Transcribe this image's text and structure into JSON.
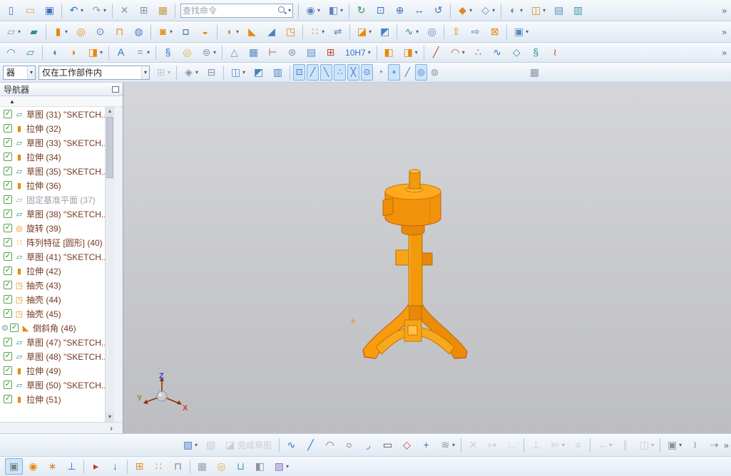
{
  "search": {
    "placeholder": "查找命令"
  },
  "navigator": {
    "title": "导航器",
    "sort_indicator": "▲",
    "expand_glyph": "›",
    "check_glyph": "✓",
    "scroll_up_glyph": "▲",
    "scroll_down_glyph": "▼",
    "icon_glyphs": {
      "sketch": [
        "▱",
        "#2e8f8f"
      ],
      "extrude": [
        "▮",
        "#e8890a"
      ],
      "datum-plane": [
        "▱",
        "#8a94a0"
      ],
      "revolve": [
        "◎",
        "#e8890a"
      ],
      "pattern": [
        "∷",
        "#e8890a"
      ],
      "shell": [
        "◳",
        "#e8890a"
      ],
      "chamfer": [
        "◣",
        "#e8890a"
      ]
    },
    "items": [
      {
        "label": "草图 (31) \"SKETCH...",
        "icon": "sketch"
      },
      {
        "label": "拉伸 (32)",
        "icon": "extrude"
      },
      {
        "label": "草图 (33) \"SKETCH...",
        "icon": "sketch"
      },
      {
        "label": "拉伸 (34)",
        "icon": "extrude"
      },
      {
        "label": "草图 (35) \"SKETCH...",
        "icon": "sketch"
      },
      {
        "label": "拉伸 (36)",
        "icon": "extrude"
      },
      {
        "label": "固定基准平面 (37)",
        "icon": "datum-plane",
        "muted": true
      },
      {
        "label": "草图 (38) \"SKETCH...",
        "icon": "sketch"
      },
      {
        "label": "旋转 (39)",
        "icon": "revolve"
      },
      {
        "label": "阵列特征 [圆形] (40)",
        "icon": "pattern"
      },
      {
        "label": "草图 (41) \"SKETCH...",
        "icon": "sketch"
      },
      {
        "label": "拉伸 (42)",
        "icon": "extrude"
      },
      {
        "label": "抽壳 (43)",
        "icon": "shell"
      },
      {
        "label": "抽壳 (44)",
        "icon": "shell"
      },
      {
        "label": "抽壳 (45)",
        "icon": "shell"
      },
      {
        "label": "倒斜角 (46)",
        "icon": "chamfer",
        "info": true
      },
      {
        "label": "草图 (47) \"SKETCH...",
        "icon": "sketch"
      },
      {
        "label": "草图 (48) \"SKETCH...",
        "icon": "sketch"
      },
      {
        "label": "拉伸 (49)",
        "icon": "extrude"
      },
      {
        "label": "草图 (50) \"SKETCH...",
        "icon": "sketch"
      },
      {
        "label": "拉伸 (51)",
        "icon": "extrude"
      }
    ]
  },
  "viewport": {
    "cursor_marker": "+",
    "triad": {
      "x": "X",
      "y": "Y",
      "z": "Z"
    }
  },
  "toolbars": {
    "row1": [
      {
        "n": "new-file-button",
        "g": "▯",
        "c": "#4a7fc1"
      },
      {
        "n": "open-button",
        "g": "▭",
        "c": "#e8a33d"
      },
      {
        "n": "save-button",
        "g": "▣",
        "c": "#3f6fbf"
      },
      {
        "sep": true
      },
      {
        "n": "undo-button",
        "g": "↶",
        "c": "#2f6fd0",
        "dd": true
      },
      {
        "n": "redo-button",
        "g": "↷",
        "c": "#8fa3c0",
        "dd": true
      },
      {
        "sep": true
      },
      {
        "n": "cut-button",
        "g": "✕",
        "c": "#8a94a0"
      },
      {
        "n": "copy-button",
        "g": "⊞",
        "c": "#8a94a0"
      },
      {
        "n": "paste-button",
        "g": "▦",
        "c": "#c89a3f"
      },
      {
        "sep": true
      },
      {
        "search": true
      },
      {
        "sep": true
      },
      {
        "n": "touch-mode-button",
        "g": "◉",
        "c": "#5a87c5",
        "dd": true
      },
      {
        "n": "window-button",
        "g": "◧",
        "c": "#5a87c5",
        "dd": true
      },
      {
        "sep": true
      },
      {
        "n": "refresh-view-button",
        "g": "↻",
        "c": "#2f8f4f"
      },
      {
        "n": "fit-view-button",
        "g": "⊡",
        "c": "#3f6fbf"
      },
      {
        "n": "zoom-in-button",
        "g": "⊕",
        "c": "#3f6fbf"
      },
      {
        "n": "pan-view-button",
        "g": "↔",
        "c": "#3f6fbf"
      },
      {
        "n": "rotate-view-button",
        "g": "↺",
        "c": "#3f6fbf"
      },
      {
        "sep": true
      },
      {
        "n": "shaded-display-button",
        "g": "◆",
        "c": "#d98a2b",
        "dd": true
      },
      {
        "n": "wireframe-display-button",
        "g": "◇",
        "c": "#6a7fd0",
        "dd": true
      },
      {
        "sep": true
      },
      {
        "n": "show-hide-button",
        "g": "◐",
        "c": "#5a87c5",
        "dd": true
      },
      {
        "n": "view-section-button",
        "g": "◫",
        "c": "#d98a2b",
        "dd": true
      },
      {
        "n": "layer-settings-button",
        "g": "▤",
        "c": "#5a87c5"
      },
      {
        "n": "true-shading-button",
        "g": "▥",
        "c": "#3aa0a0"
      },
      {
        "chev": true,
        "n": "row1-overflow"
      }
    ],
    "row2": [
      {
        "n": "datum-plane-button",
        "g": "▱",
        "c": "#8a94a0",
        "dd": true
      },
      {
        "n": "sketch-button",
        "g": "▰",
        "c": "#2e8f8f"
      },
      {
        "sep": true
      },
      {
        "n": "extrude-button",
        "g": "▮",
        "c": "#e8890a",
        "dd": true
      },
      {
        "n": "revolve-button",
        "g": "◎",
        "c": "#e8890a"
      },
      {
        "n": "hole-button",
        "g": "⊙",
        "c": "#4a7fc1"
      },
      {
        "n": "rib-button",
        "g": "⊓",
        "c": "#e8890a"
      },
      {
        "n": "boss-button",
        "g": "◍",
        "c": "#4a7fc1"
      },
      {
        "sep": true
      },
      {
        "n": "unite-button",
        "g": "◙",
        "c": "#e8890a",
        "dd": true
      },
      {
        "n": "subtract-button",
        "g": "◘",
        "c": "#4a7fc1"
      },
      {
        "n": "intersect-button",
        "g": "◒",
        "c": "#e8890a"
      },
      {
        "sep": true
      },
      {
        "n": "edge-blend-button",
        "g": "◗",
        "c": "#e8890a",
        "dd": true
      },
      {
        "n": "chamfer-button",
        "g": "◣",
        "c": "#e8890a"
      },
      {
        "n": "draft-button",
        "g": "◢",
        "c": "#4a7fc1"
      },
      {
        "n": "shell-button",
        "g": "◳",
        "c": "#e8890a"
      },
      {
        "sep": true
      },
      {
        "n": "pattern-feature-button",
        "g": "∷",
        "c": "#e8890a",
        "dd": true
      },
      {
        "n": "mirror-feature-button",
        "g": "⇌",
        "c": "#4a7fc1"
      },
      {
        "sep": true
      },
      {
        "n": "trim-body-button",
        "g": "◪",
        "c": "#e8890a",
        "dd": true
      },
      {
        "n": "split-body-button",
        "g": "◩",
        "c": "#4a7fc1"
      },
      {
        "sep": true
      },
      {
        "n": "swept-button",
        "g": "∿",
        "c": "#2e8f8f",
        "dd": true
      },
      {
        "n": "tube-button",
        "g": "◎",
        "c": "#4a7fc1"
      },
      {
        "sep": true
      },
      {
        "n": "offset-face-button",
        "g": "⇧",
        "c": "#e8890a"
      },
      {
        "n": "move-face-button",
        "g": "⇨",
        "c": "#4a7fc1"
      },
      {
        "n": "delete-face-button",
        "g": "⊠",
        "c": "#e8890a"
      },
      {
        "sep": true
      },
      {
        "n": "more-features-button",
        "g": "▣",
        "c": "#5a87c5",
        "dd": true
      },
      {
        "chev": true,
        "n": "row2-overflow"
      }
    ],
    "row3": [
      {
        "n": "through-curves-button",
        "g": "◠",
        "c": "#2e8f8f"
      },
      {
        "n": "ruled-surface-button",
        "g": "▱",
        "c": "#2e8f8f"
      },
      {
        "sep": true
      },
      {
        "n": "bend-sheet-button",
        "g": "◖",
        "c": "#4a7fc1"
      },
      {
        "n": "flange-button",
        "g": "◗",
        "c": "#e8890a"
      },
      {
        "n": "sheet-metal-button",
        "g": "◨",
        "c": "#e8890a",
        "dd": true
      },
      {
        "sep": true
      },
      {
        "n": "text-button",
        "g": "A",
        "c": "#2f6fd0"
      },
      {
        "n": "expression-button",
        "g": "=",
        "c": "#8a6fc0",
        "dd": true
      },
      {
        "sep": true
      },
      {
        "n": "spring-button",
        "g": "§",
        "c": "#2f6fd0"
      },
      {
        "n": "coil-button",
        "g": "◎",
        "c": "#d9b23d"
      },
      {
        "n": "thread-button",
        "g": "⊜",
        "c": "#8a94a0",
        "dd": true
      },
      {
        "sep": true
      },
      {
        "n": "measure-button",
        "g": "△",
        "c": "#8a94a0"
      },
      {
        "n": "spreadsheet-button",
        "g": "▦",
        "c": "#5a87c5"
      },
      {
        "n": "dimension-button",
        "g": "⊢",
        "c": "#c04a3a"
      },
      {
        "n": "gear-pair-button",
        "g": "⊛",
        "c": "#8a94a0"
      },
      {
        "n": "note-button",
        "g": "▤",
        "c": "#5a87c5"
      },
      {
        "n": "feature-control-frame-button",
        "g": "⊞",
        "c": "#c04a3a"
      },
      {
        "n": "tolerance-button",
        "lbl": "10H7",
        "c": "#2f6fd0",
        "dd": true
      },
      {
        "sep": true
      },
      {
        "n": "add-component-button",
        "g": "◧",
        "c": "#e8890a"
      },
      {
        "n": "assembly-constraints-button",
        "g": "◨",
        "c": "#e8890a",
        "dd": true
      },
      {
        "sep": true
      },
      {
        "n": "line-curve-button",
        "g": "╱",
        "c": "#c04a3a"
      },
      {
        "n": "arc-curve-button",
        "g": "◠",
        "c": "#c04a3a",
        "dd": true
      },
      {
        "n": "point-set-button",
        "g": "∴",
        "c": "#c04a3a"
      },
      {
        "n": "studio-spline-button",
        "g": "∿",
        "c": "#2f6fd0"
      },
      {
        "n": "surface-sheet-button",
        "g": "◇",
        "c": "#2e8f8f"
      },
      {
        "n": "helix-button",
        "g": "§",
        "c": "#2e8f8f"
      },
      {
        "n": "bridge-curve-button",
        "g": "≀",
        "c": "#c04a3a"
      },
      {
        "chev": true,
        "n": "row3-overflow"
      }
    ],
    "row4": [
      {
        "combo": true,
        "n": "type-filter-combo",
        "v": "器",
        "w": 46
      },
      {
        "combo": true,
        "n": "selection-scope-combo",
        "v": "仅在工作部件内",
        "w": 156
      },
      {
        "n": "select-all-button",
        "g": "⊞",
        "c": "#8a94a0",
        "dd": true,
        "dis": true
      },
      {
        "sep": true
      },
      {
        "n": "highlight-selection-button",
        "g": "◈",
        "c": "#8a94a0",
        "dd": true
      },
      {
        "n": "deselect-button",
        "g": "⊟",
        "c": "#8a94a0"
      },
      {
        "sep": true
      },
      {
        "n": "top-level-selection-button",
        "g": "◫",
        "c": "#5a87c5",
        "dd": true
      },
      {
        "n": "face-rule-button",
        "g": "◩",
        "c": "#4a7fc1"
      },
      {
        "n": "body-rule-button",
        "g": "▥",
        "c": "#4a7fc1"
      },
      {
        "sep": true
      },
      {
        "n": "enable-snap-point-button",
        "g": "⊡",
        "c": "#2f6fd0",
        "active": true,
        "sm": true
      },
      {
        "n": "snap-endpoint-button",
        "g": "╱",
        "c": "#2f6fd0",
        "active": true,
        "sm": true
      },
      {
        "n": "snap-midpoint-button",
        "g": "╲",
        "c": "#2f6fd0",
        "active": true,
        "sm": true
      },
      {
        "n": "snap-control-point-button",
        "g": "∴",
        "c": "#2f6fd0",
        "active": true,
        "sm": true
      },
      {
        "n": "snap-intersection-button",
        "g": "╳",
        "c": "#2f6fd0",
        "active": true,
        "sm": true
      },
      {
        "n": "snap-arc-center-button",
        "g": "⊙",
        "c": "#2f6fd0",
        "active": true,
        "sm": true
      },
      {
        "n": "snap-quadrant-button",
        "g": "◔",
        "c": "#2f6fd0",
        "sm": true
      },
      {
        "n": "snap-existing-point-button",
        "g": "+",
        "c": "#2f6fd0",
        "active": true,
        "sm": true
      },
      {
        "n": "snap-point-on-curve-button",
        "g": "╱",
        "c": "#2f6fd0",
        "sm": true
      },
      {
        "n": "snap-tangent-button",
        "g": "◎",
        "c": "#2f6fd0",
        "active": true,
        "sm": true
      },
      {
        "n": "snap-point-on-face-button",
        "g": "◍",
        "c": "#8a94a0",
        "sm": true
      },
      {
        "n": "point-dialog-button",
        "g": "▦",
        "c": "#8a94a0",
        "ml": 118
      }
    ],
    "sketchbar": [
      {
        "n": "sketch-task-button",
        "g": "▧",
        "c": "#4a7fc1",
        "dd": true
      },
      {
        "n": "sketch-orient-button",
        "g": "▨",
        "c": "#9aa0a6",
        "dis": true
      },
      {
        "n": "finish-sketch-button",
        "g": "◪",
        "c": "#9aa0a6",
        "lbl": "完成草图",
        "dis": true
      },
      {
        "sep": true
      },
      {
        "n": "profile-button",
        "g": "∿",
        "c": "#2f6fd0"
      },
      {
        "n": "line-button",
        "g": "╱",
        "c": "#2f6fd0"
      },
      {
        "n": "arc-button",
        "g": "◠",
        "c": "#c04a3a"
      },
      {
        "n": "circle-button",
        "g": "○",
        "c": "#444a52"
      },
      {
        "n": "fillet-button",
        "g": "◞",
        "c": "#2f6fd0"
      },
      {
        "n": "rectangle-button",
        "g": "▭",
        "c": "#444a52"
      },
      {
        "n": "polygon-button",
        "g": "◇",
        "c": "#c04a3a"
      },
      {
        "n": "point-button",
        "g": "+",
        "c": "#2f6fd0"
      },
      {
        "n": "offset-curve-button",
        "g": "≋",
        "c": "#8a94a0",
        "dd": true
      },
      {
        "sep": true
      },
      {
        "n": "quick-trim-button",
        "g": "✕",
        "c": "#9aa0a6",
        "dis": true
      },
      {
        "n": "quick-extend-button",
        "g": "↦",
        "c": "#9aa0a6",
        "dis": true
      },
      {
        "n": "make-corner-button",
        "g": "∟",
        "c": "#9aa0a6",
        "dis": true
      },
      {
        "sep": true
      },
      {
        "n": "geometric-constraints-button",
        "g": "⊥",
        "c": "#9aa0a6",
        "dis": true
      },
      {
        "n": "auto-constrain-button",
        "g": "⊨",
        "c": "#9aa0a6",
        "dis": true,
        "dd": true
      },
      {
        "n": "show-constraints-button",
        "g": "≡",
        "c": "#9aa0a6",
        "dis": true
      },
      {
        "sep": true
      },
      {
        "n": "rapid-dimension-button",
        "g": "↔",
        "c": "#9aa0a6",
        "dis": true,
        "dd": true
      },
      {
        "n": "parallel-dimension-button",
        "g": "∥",
        "c": "#9aa0a6",
        "dis": true
      },
      {
        "n": "constraint-settings-button",
        "g": "◫",
        "c": "#9aa0a6",
        "dis": true,
        "dd": true
      },
      {
        "sep": true
      },
      {
        "n": "sketch-tools-button",
        "g": "▣",
        "c": "#8a94a0",
        "dd": true
      },
      {
        "n": "edit-curve-button",
        "g": "≀",
        "c": "#8a94a0"
      },
      {
        "n": "convert-reference-button",
        "g": "⇢",
        "c": "#8a94a0"
      },
      {
        "chev": true,
        "n": "sketchbar-overflow"
      }
    ],
    "bottombar": [
      {
        "n": "touch-panel-button",
        "g": "▣",
        "c": "#7a8288",
        "active": true
      },
      {
        "n": "user-role-button",
        "g": "◉",
        "c": "#e8890a"
      },
      {
        "n": "point-constructor-button",
        "g": "∗",
        "c": "#e07b2a"
      },
      {
        "n": "datum-csys-button",
        "g": "⊥",
        "c": "#2f6fd0"
      },
      {
        "sep": true
      },
      {
        "n": "marker-flags-button",
        "g": "▸",
        "c": "#c03a2a"
      },
      {
        "n": "edit-object-display-button",
        "g": "↓",
        "c": "#2f6fd0"
      },
      {
        "sep": true
      },
      {
        "n": "move-object-button",
        "g": "⊞",
        "c": "#e0902a"
      },
      {
        "n": "pattern-geometry-button",
        "g": "∷",
        "c": "#e0902a"
      },
      {
        "n": "clamp-tool-button",
        "g": "⊓",
        "c": "#7a8288"
      },
      {
        "sep": true
      },
      {
        "n": "block-tool-button",
        "g": "▦",
        "c": "#9aa0a6"
      },
      {
        "n": "washer-tool-button",
        "g": "◎",
        "c": "#d9b23d"
      },
      {
        "n": "slot-tool-button",
        "g": "⊔",
        "c": "#3aa0a0"
      },
      {
        "n": "cube-tool-button",
        "g": "◧",
        "c": "#8a94a0"
      },
      {
        "n": "more-tools-button",
        "g": "▧",
        "c": "#8a6fc0",
        "dd": true
      }
    ]
  }
}
